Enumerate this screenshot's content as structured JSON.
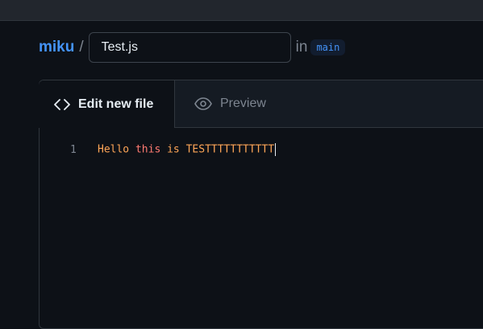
{
  "breadcrumb": {
    "repo": "miku",
    "separator": "/",
    "filename_value": "Test.js",
    "in_label": "in",
    "branch": "main"
  },
  "tabs": [
    {
      "label": "Edit new file",
      "icon": "code-icon",
      "active": true
    },
    {
      "label": "Preview",
      "icon": "eye-icon",
      "active": false
    }
  ],
  "editor": {
    "lines": [
      {
        "number": "1",
        "tokens": [
          {
            "text": "Hello ",
            "color": "#ffa657"
          },
          {
            "text": "this",
            "color": "#ff7b72"
          },
          {
            "text": " is TESTTTTTTTTTTT",
            "color": "#ffa657"
          }
        ]
      }
    ]
  },
  "colors": {
    "background": "#0d1117",
    "accent": "#4493f8",
    "topbar": "#22262d",
    "tab_bar": "#151b23"
  }
}
